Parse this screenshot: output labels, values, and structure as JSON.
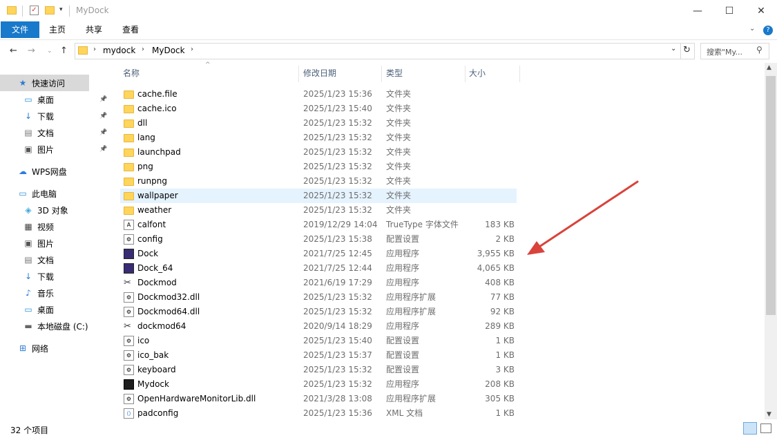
{
  "window": {
    "title": "MyDock",
    "controls": {
      "minimize": "—",
      "maximize": "☐",
      "close": "✕"
    }
  },
  "ribbon": {
    "tabs": [
      "文件",
      "主页",
      "共享",
      "查看"
    ]
  },
  "address": {
    "path": [
      "mydock",
      "MyDock"
    ],
    "search_placeholder": "搜索\"My..."
  },
  "sidebar": {
    "items": [
      {
        "label": "快速访问",
        "icon": "star-icon",
        "indent": 0,
        "selected": true
      },
      {
        "label": "桌面",
        "icon": "desktop-icon",
        "indent": 1,
        "pinned": true
      },
      {
        "label": "下载",
        "icon": "download-icon",
        "indent": 1,
        "pinned": true
      },
      {
        "label": "文档",
        "icon": "document-icon",
        "indent": 1,
        "pinned": true
      },
      {
        "label": "图片",
        "icon": "picture-icon",
        "indent": 1,
        "pinned": true
      },
      {
        "label": "WPS网盘",
        "icon": "cloud-icon",
        "indent": 0
      },
      {
        "label": "此电脑",
        "icon": "computer-icon",
        "indent": 0
      },
      {
        "label": "3D 对象",
        "icon": "cube-icon",
        "indent": 1
      },
      {
        "label": "视频",
        "icon": "video-icon",
        "indent": 1
      },
      {
        "label": "图片",
        "icon": "picture-icon",
        "indent": 1
      },
      {
        "label": "文档",
        "icon": "document-icon",
        "indent": 1
      },
      {
        "label": "下载",
        "icon": "download-icon",
        "indent": 1
      },
      {
        "label": "音乐",
        "icon": "music-icon",
        "indent": 1
      },
      {
        "label": "桌面",
        "icon": "desktop-icon",
        "indent": 1
      },
      {
        "label": "本地磁盘 (C:)",
        "icon": "drive-icon",
        "indent": 1
      },
      {
        "label": "网络",
        "icon": "network-icon",
        "indent": 0
      }
    ]
  },
  "columns": [
    "名称",
    "修改日期",
    "类型",
    "大小"
  ],
  "files": [
    {
      "name": "cache.file",
      "date": "2025/1/23 15:36",
      "type": "文件夹",
      "size": "",
      "icon": "folder"
    },
    {
      "name": "cache.ico",
      "date": "2025/1/23 15:40",
      "type": "文件夹",
      "size": "",
      "icon": "folder"
    },
    {
      "name": "dll",
      "date": "2025/1/23 15:32",
      "type": "文件夹",
      "size": "",
      "icon": "folder"
    },
    {
      "name": "lang",
      "date": "2025/1/23 15:32",
      "type": "文件夹",
      "size": "",
      "icon": "folder"
    },
    {
      "name": "launchpad",
      "date": "2025/1/23 15:32",
      "type": "文件夹",
      "size": "",
      "icon": "folder"
    },
    {
      "name": "png",
      "date": "2025/1/23 15:32",
      "type": "文件夹",
      "size": "",
      "icon": "folder"
    },
    {
      "name": "runpng",
      "date": "2025/1/23 15:32",
      "type": "文件夹",
      "size": "",
      "icon": "folder"
    },
    {
      "name": "wallpaper",
      "date": "2025/1/23 15:32",
      "type": "文件夹",
      "size": "",
      "icon": "folder",
      "selected": true
    },
    {
      "name": "weather",
      "date": "2025/1/23 15:32",
      "type": "文件夹",
      "size": "",
      "icon": "folder"
    },
    {
      "name": "calfont",
      "date": "2019/12/29 14:04",
      "type": "TrueType 字体文件",
      "size": "183 KB",
      "icon": "font"
    },
    {
      "name": "config",
      "date": "2025/1/23 15:38",
      "type": "配置设置",
      "size": "2 KB",
      "icon": "config"
    },
    {
      "name": "Dock",
      "date": "2021/7/25 12:45",
      "type": "应用程序",
      "size": "3,955 KB",
      "icon": "app"
    },
    {
      "name": "Dock_64",
      "date": "2021/7/25 12:44",
      "type": "应用程序",
      "size": "4,065 KB",
      "icon": "app"
    },
    {
      "name": "Dockmod",
      "date": "2021/6/19 17:29",
      "type": "应用程序",
      "size": "408 KB",
      "icon": "tool"
    },
    {
      "name": "Dockmod32.dll",
      "date": "2025/1/23 15:32",
      "type": "应用程序扩展",
      "size": "77 KB",
      "icon": "dll"
    },
    {
      "name": "Dockmod64.dll",
      "date": "2025/1/23 15:32",
      "type": "应用程序扩展",
      "size": "92 KB",
      "icon": "dll"
    },
    {
      "name": "dockmod64",
      "date": "2020/9/14 18:29",
      "type": "应用程序",
      "size": "289 KB",
      "icon": "tool"
    },
    {
      "name": "ico",
      "date": "2025/1/23 15:40",
      "type": "配置设置",
      "size": "1 KB",
      "icon": "config"
    },
    {
      "name": "ico_bak",
      "date": "2025/1/23 15:37",
      "type": "配置设置",
      "size": "1 KB",
      "icon": "config"
    },
    {
      "name": "keyboard",
      "date": "2025/1/23 15:32",
      "type": "配置设置",
      "size": "3 KB",
      "icon": "config"
    },
    {
      "name": "Mydock",
      "date": "2025/1/23 15:32",
      "type": "应用程序",
      "size": "208 KB",
      "icon": "appblack"
    },
    {
      "name": "OpenHardwareMonitorLib.dll",
      "date": "2021/3/28 13:08",
      "type": "应用程序扩展",
      "size": "305 KB",
      "icon": "dll"
    },
    {
      "name": "padconfig",
      "date": "2025/1/23 15:36",
      "type": "XML 文档",
      "size": "1 KB",
      "icon": "xml"
    }
  ],
  "status": {
    "count": "32 个项目"
  },
  "colors": {
    "accent": "#1979ca",
    "selection": "#e5f3ff",
    "arrow": "#d9433a"
  }
}
